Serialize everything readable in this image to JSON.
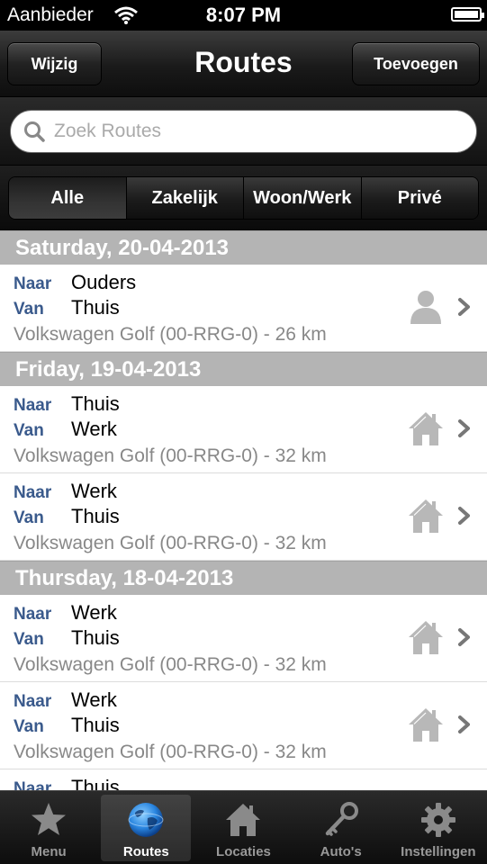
{
  "status": {
    "carrier": "Aanbieder",
    "time": "8:07 PM"
  },
  "nav": {
    "title": "Routes",
    "left_button": "Wijzig",
    "right_button": "Toevoegen"
  },
  "search": {
    "placeholder": "Zoek Routes",
    "value": ""
  },
  "filters": [
    "Alle",
    "Zakelijk",
    "Woon/Werk",
    "Privé"
  ],
  "labels": {
    "to": "Naar",
    "from": "Van"
  },
  "sections": [
    {
      "header": "Saturday, 20-04-2013",
      "rows": [
        {
          "to": "Ouders",
          "from": "Thuis",
          "detail": "Volkswagen Golf (00-RRG-0) - 26 km",
          "icon": "person-icon"
        }
      ]
    },
    {
      "header": "Friday, 19-04-2013",
      "rows": [
        {
          "to": "Thuis",
          "from": "Werk",
          "detail": "Volkswagen Golf (00-RRG-0) - 32 km",
          "icon": "house-icon"
        },
        {
          "to": "Werk",
          "from": "Thuis",
          "detail": "Volkswagen Golf (00-RRG-0) - 32 km",
          "icon": "house-icon"
        }
      ]
    },
    {
      "header": "Thursday, 18-04-2013",
      "rows": [
        {
          "to": "Werk",
          "from": "Thuis",
          "detail": "Volkswagen Golf (00-RRG-0) - 32 km",
          "icon": "house-icon"
        },
        {
          "to": "Werk",
          "from": "Thuis",
          "detail": "Volkswagen Golf (00-RRG-0) - 32 km",
          "icon": "house-icon"
        },
        {
          "to": "Thuis",
          "from": "",
          "detail": "",
          "icon": "house-icon"
        }
      ]
    }
  ],
  "tabs": [
    {
      "label": "Menu",
      "icon": "star-icon",
      "active": false
    },
    {
      "label": "Routes",
      "icon": "globe-icon",
      "active": true
    },
    {
      "label": "Locaties",
      "icon": "house-icon",
      "active": false
    },
    {
      "label": "Auto's",
      "icon": "key-icon",
      "active": false
    },
    {
      "label": "Instellingen",
      "icon": "gear-icon",
      "active": false
    }
  ]
}
